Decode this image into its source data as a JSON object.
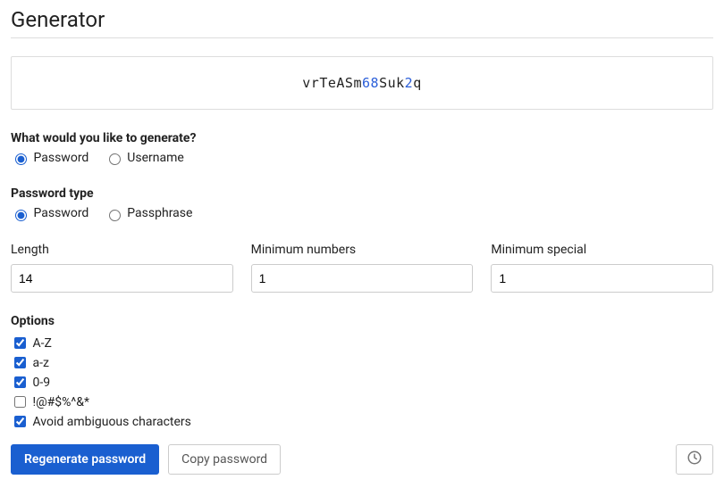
{
  "title": "Generator",
  "password": {
    "segments": [
      {
        "text": "vrTeASm",
        "type": "alpha"
      },
      {
        "text": "68",
        "type": "digit"
      },
      {
        "text": "Suk",
        "type": "alpha"
      },
      {
        "text": "2",
        "type": "digit"
      },
      {
        "text": "q",
        "type": "alpha"
      }
    ]
  },
  "generateWhat": {
    "label": "What would you like to generate?",
    "options": {
      "password": "Password",
      "username": "Username"
    },
    "selected": "password"
  },
  "passwordType": {
    "label": "Password type",
    "options": {
      "password": "Password",
      "passphrase": "Passphrase"
    },
    "selected": "password"
  },
  "numbers": {
    "length": {
      "label": "Length",
      "value": "14"
    },
    "minNumbers": {
      "label": "Minimum numbers",
      "value": "1"
    },
    "minSpecial": {
      "label": "Minimum special",
      "value": "1"
    }
  },
  "options": {
    "label": "Options",
    "upper": {
      "label": "A-Z",
      "checked": true
    },
    "lower": {
      "label": "a-z",
      "checked": true
    },
    "digits": {
      "label": "0-9",
      "checked": true
    },
    "special": {
      "label": "!@#$%^&*",
      "checked": false
    },
    "ambiguous": {
      "label": "Avoid ambiguous characters",
      "checked": true
    }
  },
  "buttons": {
    "regenerate": "Regenerate password",
    "copy": "Copy password"
  }
}
